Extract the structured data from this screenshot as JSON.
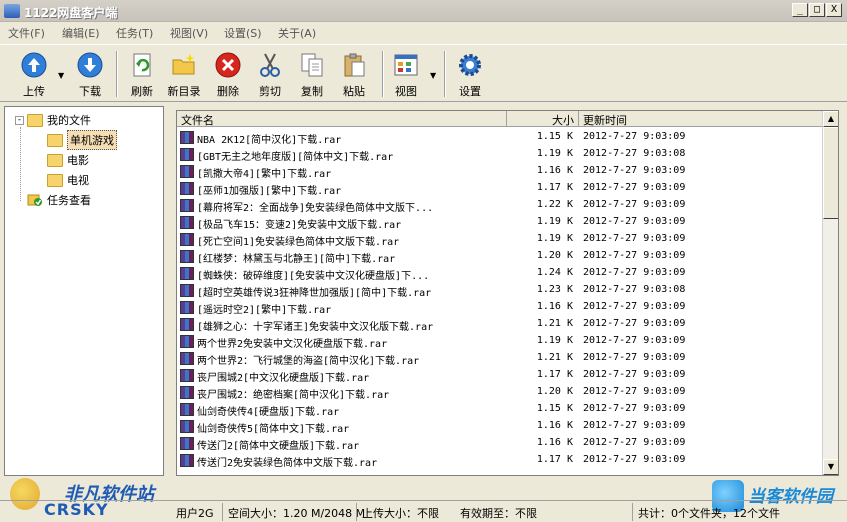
{
  "window": {
    "title": "1122网盘客户端",
    "controls": {
      "minimize": "_",
      "maximize": "□",
      "close": "X"
    }
  },
  "menu": [
    "文件(F)",
    "编辑(E)",
    "任务(T)",
    "视图(V)",
    "设置(S)",
    "关于(A)"
  ],
  "toolbar": {
    "upload": "上传",
    "download": "下载",
    "refresh": "刷新",
    "new_folder": "新目录",
    "delete": "删除",
    "cut": "剪切",
    "copy": "复制",
    "paste": "粘贴",
    "view": "视图",
    "settings": "设置",
    "dropdown_glyph": "▼"
  },
  "tree": {
    "root": "我的文件",
    "children": [
      "单机游戏",
      "电影",
      "电视"
    ],
    "tasks": "任务查看",
    "expander_glyph": "-"
  },
  "list": {
    "columns": {
      "name": "文件名",
      "size": "大小",
      "time": "更新时间"
    },
    "rows": [
      {
        "name": "NBA 2K12[简中汉化]下载.rar",
        "size": "1.15 K",
        "time": "2012-7-27  9:03:09"
      },
      {
        "name": "[GBT无主之地年度版][简体中文]下载.rar",
        "size": "1.19 K",
        "time": "2012-7-27  9:03:08"
      },
      {
        "name": "[凯撒大帝4][繁中]下载.rar",
        "size": "1.16 K",
        "time": "2012-7-27  9:03:09"
      },
      {
        "name": "[巫师1加强版][繁中]下载.rar",
        "size": "1.17 K",
        "time": "2012-7-27  9:03:09"
      },
      {
        "name": "[幕府将军2：全面战争]免安装绿色简体中文版下...",
        "size": "1.22 K",
        "time": "2012-7-27  9:03:09"
      },
      {
        "name": "[极品飞车15：变速2]免安装中文版下载.rar",
        "size": "1.19 K",
        "time": "2012-7-27  9:03:09"
      },
      {
        "name": "[死亡空间1]免安装绿色简体中文版下载.rar",
        "size": "1.19 K",
        "time": "2012-7-27  9:03:09"
      },
      {
        "name": "[红楼梦：林黛玉与北静王][简中]下载.rar",
        "size": "1.20 K",
        "time": "2012-7-27  9:03:09"
      },
      {
        "name": "[蜘蛛侠：破碎维度][免安装中文汉化硬盘版]下...",
        "size": "1.24 K",
        "time": "2012-7-27  9:03:09"
      },
      {
        "name": "[超时空英雄传说3狂神降世加强版][简中]下载.rar",
        "size": "1.23 K",
        "time": "2012-7-27  9:03:08"
      },
      {
        "name": "[遥远时空2][繁中]下载.rar",
        "size": "1.16 K",
        "time": "2012-7-27  9:03:09"
      },
      {
        "name": "[雄狮之心：十字军诸王]免安装中文汉化版下载.rar",
        "size": "1.21 K",
        "time": "2012-7-27  9:03:09"
      },
      {
        "name": "两个世界2免安装中文汉化硬盘版下载.rar",
        "size": "1.19 K",
        "time": "2012-7-27  9:03:09"
      },
      {
        "name": "两个世界2：飞行城堡的海盗[简中汉化]下载.rar",
        "size": "1.21 K",
        "time": "2012-7-27  9:03:09"
      },
      {
        "name": "丧尸围城2[中文汉化硬盘版]下载.rar",
        "size": "1.17 K",
        "time": "2012-7-27  9:03:09"
      },
      {
        "name": "丧尸围城2：绝密档案[简中汉化]下载.rar",
        "size": "1.20 K",
        "time": "2012-7-27  9:03:09"
      },
      {
        "name": "仙剑奇侠传4[硬盘版]下载.rar",
        "size": "1.15 K",
        "time": "2012-7-27  9:03:09"
      },
      {
        "name": "仙剑奇侠传5[简体中文]下载.rar",
        "size": "1.16 K",
        "time": "2012-7-27  9:03:09"
      },
      {
        "name": "传送门2[简体中文硬盘版]下载.rar",
        "size": "1.16 K",
        "time": "2012-7-27  9:03:09"
      },
      {
        "name": "传送门2免安装绿色简体中文版下载.rar",
        "size": "1.17 K",
        "time": "2012-7-27  9:03:09"
      }
    ]
  },
  "status": {
    "user": "用户2G",
    "space": "空间大小：1.20 M/2048 M",
    "upload_limit": "上传大小：不限",
    "validity": "有效期至：不限",
    "total": "共计：0个文件夹，12个文件"
  },
  "watermark": {
    "left_name": "非凡软件站",
    "left_sub": "CRSKY",
    "right_name": "当客软件园"
  },
  "colors": {
    "accent": "#1f5bb5",
    "selection": "#f5deb3"
  }
}
